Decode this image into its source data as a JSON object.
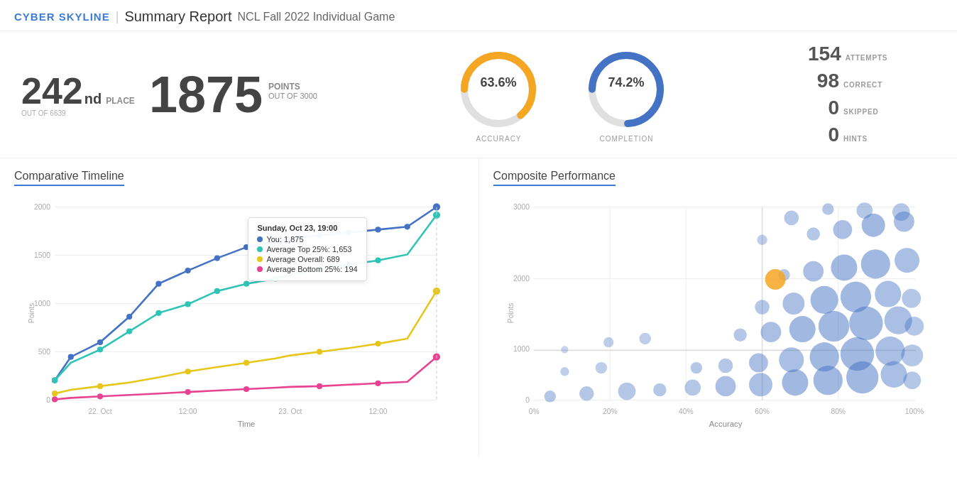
{
  "header": {
    "logo": "Cyber Skyline",
    "title": "Summary Report",
    "subtitle": "NCL Fall 2022 Individual Game"
  },
  "stats": {
    "place": "242",
    "place_suffix": "nd",
    "place_label": "PLACE",
    "place_out_of": "OUT OF 6639",
    "points": "1875",
    "points_label": "POINTS",
    "points_out_of": "OUT OF",
    "points_max": "3000",
    "accuracy_pct": "63.6%",
    "accuracy_label": "ACCURACY",
    "completion_pct": "74.2%",
    "completion_label": "COMPLETION",
    "attempts": "154",
    "attempts_label": "ATTEMPTS",
    "correct": "98",
    "correct_label": "CORRECT",
    "skipped": "0",
    "skipped_label": "SKIPPED",
    "hints": "0",
    "hints_label": "HINTS"
  },
  "timeline": {
    "title": "Comparative Timeline",
    "x_label": "Time",
    "y_label": "Points",
    "x_ticks": [
      "22. Oct",
      "12:00",
      "23. Oct",
      "12:00"
    ],
    "y_ticks": [
      "2000",
      "1500",
      "1000",
      "500",
      "0"
    ],
    "tooltip": {
      "title": "Sunday, Oct 23, 19:00",
      "rows": [
        {
          "label": "You: 1,875",
          "color": "#4472c4"
        },
        {
          "label": "Average Top 25%: 1,653",
          "color": "#2ec4b6"
        },
        {
          "label": "Average Overall: 689",
          "color": "#e6c619"
        },
        {
          "label": "Average Bottom 25%: 194",
          "color": "#e84393"
        }
      ]
    }
  },
  "composite": {
    "title": "Composite Performance",
    "x_label": "Accuracy",
    "y_label": "Points",
    "x_ticks": [
      "0%",
      "20%",
      "40%",
      "60%",
      "80%",
      "100%"
    ],
    "y_ticks": [
      "3000",
      "2000",
      "1000",
      "0"
    ]
  },
  "colors": {
    "blue": "#4472c4",
    "teal": "#2ec4b6",
    "yellow": "#e6c619",
    "pink": "#e84393",
    "orange_accent": "#f5a623",
    "accent_blue": "#3a7bd5",
    "donut_accuracy_fg": "#f5a623",
    "donut_accuracy_bg": "#e0e0e0",
    "donut_completion_fg": "#4472c4",
    "donut_completion_bg": "#e0e0e0"
  }
}
